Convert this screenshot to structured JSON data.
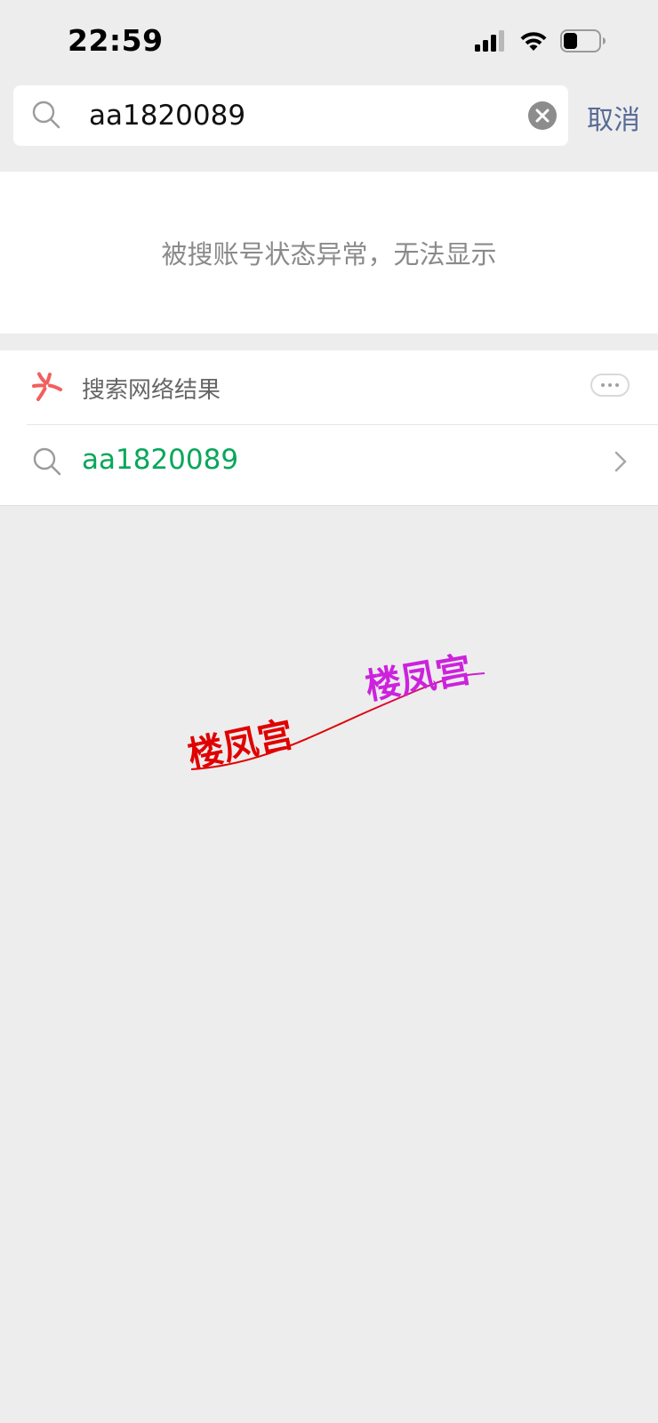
{
  "status_bar": {
    "time": "22:59",
    "icons": [
      "cellular-signal-icon",
      "wifi-icon",
      "battery-icon"
    ]
  },
  "search": {
    "value": "aa1820089",
    "cancel_label": "取消"
  },
  "notice": {
    "text": "被搜账号状态异常，无法显示"
  },
  "web_search": {
    "title": "搜索网络结果",
    "query": "aa1820089"
  },
  "watermark": {
    "text_left": "楼凤宫",
    "text_right": "楼凤宫"
  },
  "colors": {
    "background": "#ededed",
    "link_blue": "#576b95",
    "result_green": "#07a75a",
    "notice_gray": "#8a8a8a",
    "logo_red": "#f25f5c",
    "watermark_red": "#e00000",
    "watermark_purple": "#cc22dd"
  }
}
